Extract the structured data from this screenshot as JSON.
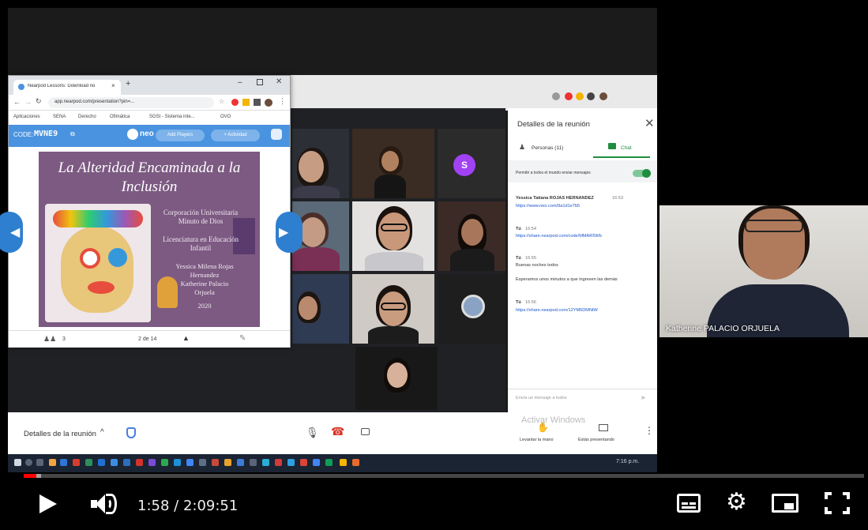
{
  "player": {
    "time_current": "1:58",
    "time_sep": " / ",
    "time_total": "2:09:51",
    "progress_fraction": 0.015
  },
  "neo_window": {
    "tab_title": "Nearpod Lessons: Download no",
    "address": "app.nearpod.com/presentation?pin=...",
    "bookmarks": [
      "Aplicaciones",
      "SENA",
      "Derecho",
      "Ofimática",
      "SGSI - Sistema inte...",
      "OVO"
    ],
    "code_label": "CODE:",
    "code_value": "MVNE9",
    "logo": "neo",
    "btn_add_players": "Add Players",
    "btn_activity": "+ Actividad",
    "slide_counter": "2 de 14",
    "students_count": "3"
  },
  "slide": {
    "title_line1": "La Alteridad Encaminada a la",
    "title_line2": "Inclusión",
    "institution_line1": "Corporación Universitaria",
    "institution_line2": "Minuto de Dios",
    "program_line1": "Licenciatura en Educación",
    "program_line2": "Infantil",
    "authors_line1": "Yessica Milena Rojas",
    "authors_line2": "Hernandez",
    "authors_line3": "Katherine Palacio",
    "authors_line4": "Orjuela",
    "year": "2020"
  },
  "meet_panel": {
    "title": "Detalles de la reunión",
    "tab_people": "Personas (11)",
    "tab_chat": "Chat",
    "allow_messages": "Permitir a todos el mundo enviar mensajes",
    "messages": [
      {
        "author": "Yessica Tatiana ROJAS HERNANDEZ",
        "time": "16:53",
        "text": "https://www.neo.com/9a1d1e7b5",
        "is_link": true
      },
      {
        "author": "Tú",
        "time": "16:54",
        "text": "https://share.nearpod.com/code/MMAR5Wb",
        "is_link": true
      },
      {
        "author": "Tú",
        "time": "16:55",
        "text": "Buenas noches todos",
        "is_link": false
      },
      {
        "author": "",
        "time": "",
        "text": "Esperamos unos minutos a que ingresen las demás",
        "is_link": false
      },
      {
        "author": "Tú",
        "time": "16:56",
        "text": "https://share.nearpod.com/12YM6DMNtW",
        "is_link": true
      }
    ],
    "input_placeholder": "Envía un mensaje a todos",
    "activate_windows": "Activar Windows",
    "raise_hand": "Levantar la mano",
    "present_now": "Estás presentando"
  },
  "meet_bar": {
    "details_label": "Detalles de la reunión"
  },
  "participants": {
    "avatar_letter": "S"
  },
  "webcam": {
    "name": "Katherine PALACIO ORJUELA"
  },
  "taskbar": {
    "clock": "7:16 p.m."
  },
  "colors": {
    "progress": "#ff0000",
    "chat_green": "#1e8e3e",
    "neo_blue": "#4a93e0",
    "avatar_purple": "#a142f4"
  }
}
